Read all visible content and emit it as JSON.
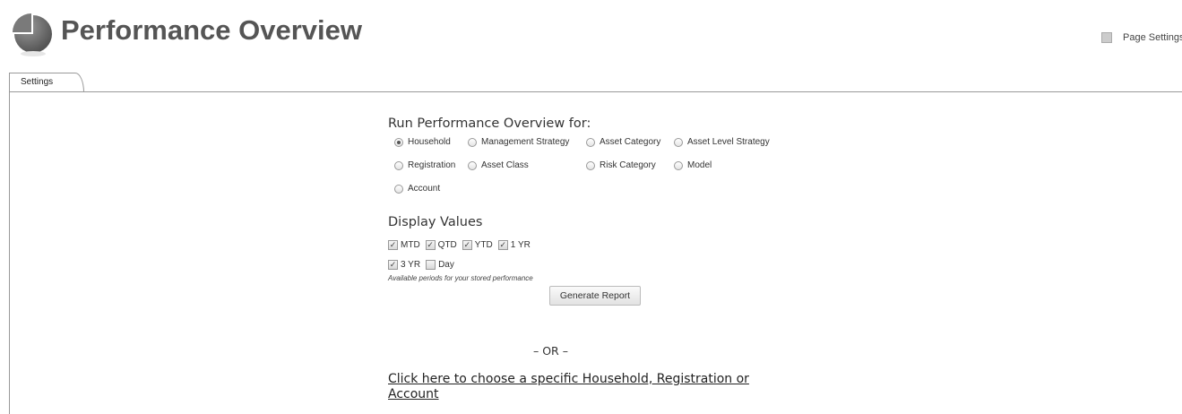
{
  "header": {
    "title": "Performance Overview",
    "page_settings_label": "Page Settings",
    "logo_icon": "pie-chart-logo-icon"
  },
  "tabs": [
    {
      "label": "Settings",
      "active": true
    }
  ],
  "run_for": {
    "heading": "Run Performance Overview for:",
    "options": [
      {
        "label": "Household",
        "selected": true
      },
      {
        "label": "Management Strategy",
        "selected": false
      },
      {
        "label": "Asset Category",
        "selected": false
      },
      {
        "label": "Asset Level Strategy",
        "selected": false
      },
      {
        "label": "Registration",
        "selected": false
      },
      {
        "label": "Asset Class",
        "selected": false
      },
      {
        "label": "Risk Category",
        "selected": false
      },
      {
        "label": "Model",
        "selected": false
      },
      {
        "label": "Account",
        "selected": false
      }
    ]
  },
  "display_values": {
    "heading": "Display Values",
    "options": [
      {
        "label": "MTD",
        "checked": true
      },
      {
        "label": "QTD",
        "checked": true
      },
      {
        "label": "YTD",
        "checked": true
      },
      {
        "label": "1 YR",
        "checked": true
      },
      {
        "label": "3 YR",
        "checked": true
      },
      {
        "label": "Day",
        "checked": false
      }
    ],
    "note": "Available periods for your stored performance"
  },
  "generate_button_label": "Generate Report",
  "or_label": "– OR –",
  "choose_link_text": "Click here to choose a specific Household, Registration or Account",
  "colors": {
    "title": "#555555",
    "border": "#999999"
  }
}
